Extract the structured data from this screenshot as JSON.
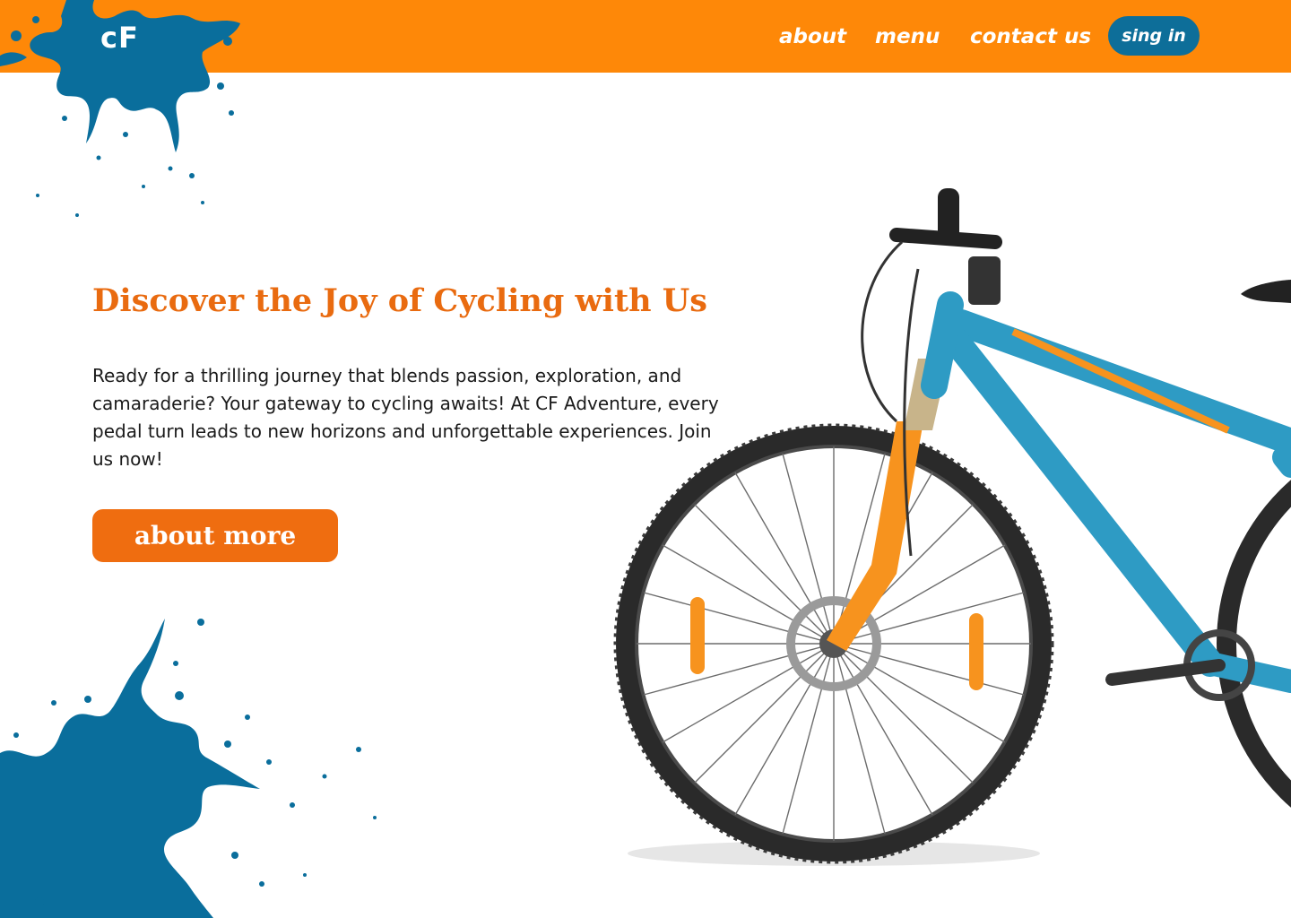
{
  "header": {
    "logo_text": "cF",
    "nav": {
      "about": "about",
      "menu": "menu",
      "contact": "contact us"
    },
    "signin_label": "sing in"
  },
  "hero": {
    "title": "Discover the Joy of Cycling with Us",
    "body": "Ready for a thrilling  journey that blends passion, exploration, and camaraderie? Your gateway to cycling awaits! At  CF Adventure, every pedal turn leads to new horizons and unforgettable experiences. Join us now!",
    "cta_label": "about more"
  },
  "colors": {
    "header_orange": "#fe8808",
    "accent_orange": "#e96b10",
    "brand_blue": "#0d6e99",
    "splash_blue": "#0a6e9c",
    "bike_frame_blue": "#2e9bc4"
  },
  "icons": [
    "paint-splash-icon",
    "bicycle-illustration"
  ]
}
